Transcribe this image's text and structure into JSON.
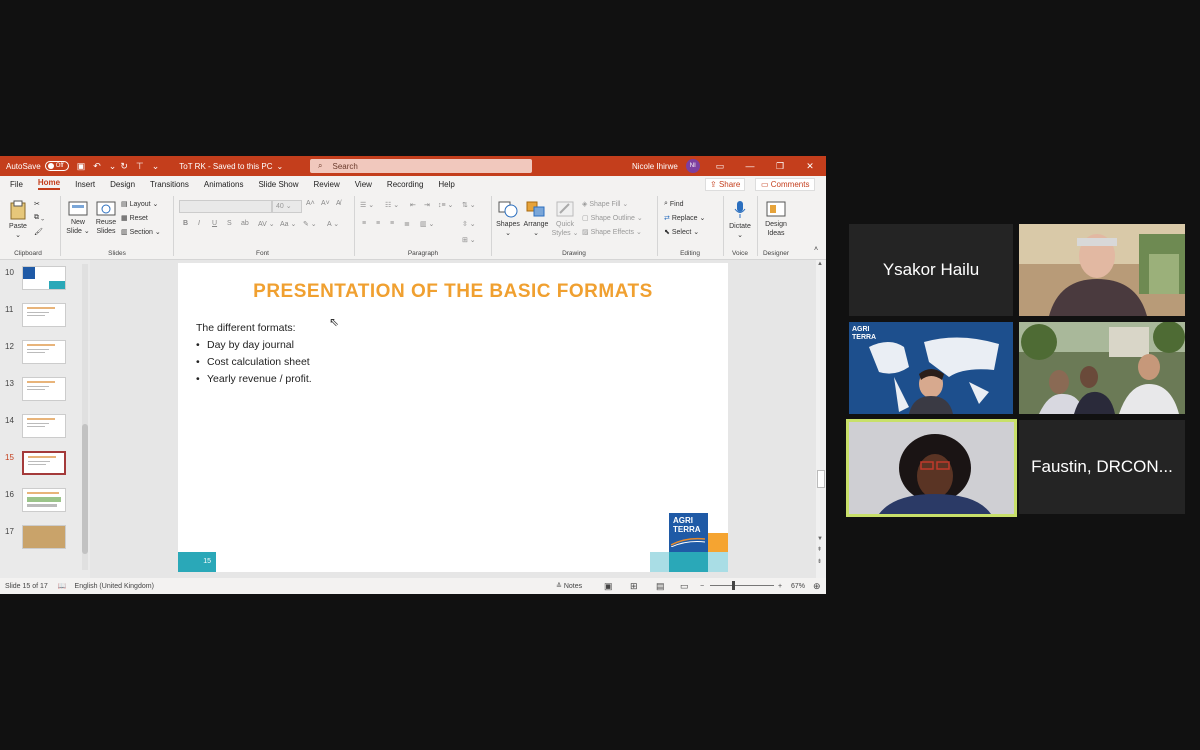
{
  "titlebar": {
    "autosave_label": "AutoSave",
    "autosave_state": "Off",
    "doc_title": "ToT RK  -  Saved to this PC",
    "doc_title_arrow": "⌄",
    "search_placeholder": "Search",
    "user_name": "Nicole Ihirwe",
    "user_initials": "NI"
  },
  "menu": {
    "tabs": [
      "File",
      "Home",
      "Insert",
      "Design",
      "Transitions",
      "Animations",
      "Slide Show",
      "Review",
      "View",
      "Recording",
      "Help"
    ],
    "active_tab": "Home",
    "share_label": "Share",
    "comments_label": "Comments"
  },
  "ribbon": {
    "clipboard": {
      "paste": "Paste",
      "label": "Clipboard"
    },
    "slides": {
      "new_slide_1": "New",
      "new_slide_2": "Slide",
      "reuse_1": "Reuse",
      "reuse_2": "Slides",
      "layout": "Layout",
      "reset": "Reset",
      "section": "Section",
      "label": "Slides"
    },
    "font": {
      "size": "40",
      "label": "Font"
    },
    "paragraph": {
      "label": "Paragraph"
    },
    "drawing": {
      "shapes": "Shapes",
      "arrange": "Arrange",
      "quick_styles_1": "Quick",
      "quick_styles_2": "Styles",
      "shape_fill": "Shape Fill",
      "shape_outline": "Shape Outline",
      "shape_effects": "Shape Effects",
      "label": "Drawing"
    },
    "editing": {
      "find": "Find",
      "replace": "Replace",
      "select": "Select",
      "label": "Editing"
    },
    "voice": {
      "dictate": "Dictate",
      "label": "Voice"
    },
    "designer": {
      "ideas_1": "Design",
      "ideas_2": "Ideas",
      "label": "Designer"
    }
  },
  "thumbnails": [
    {
      "num": "10",
      "active": false
    },
    {
      "num": "11",
      "active": false
    },
    {
      "num": "12",
      "active": false
    },
    {
      "num": "13",
      "active": false
    },
    {
      "num": "14",
      "active": false
    },
    {
      "num": "15",
      "active": true
    },
    {
      "num": "16",
      "active": false
    },
    {
      "num": "17",
      "active": false
    }
  ],
  "slide": {
    "title": "PRESENTATION OF THE BASIC FORMATS",
    "intro": "The different formats:",
    "bullets": [
      "Day by day journal",
      "Cost calculation sheet",
      "Yearly revenue / profit."
    ],
    "page_number": "15",
    "logo_line1": "AGRI",
    "logo_line2": "TERRA"
  },
  "status": {
    "slide_counter": "Slide 15 of 17",
    "language": "English (United Kingdom)",
    "notes": "Notes",
    "zoom": "67%"
  },
  "participants": {
    "p1_name": "Ysakor Hailu",
    "p2_name": "Faustin, DRCON...",
    "bg_logo_1": "AGRI",
    "bg_logo_2": "TERRA"
  },
  "colors": {
    "ppt_accent": "#c43e1c",
    "slide_title": "#f0a030",
    "active_speaker_border": "#c8e06a",
    "agriterra_blue": "#1f5aa6",
    "agriterra_teal": "#2aa8b8"
  }
}
